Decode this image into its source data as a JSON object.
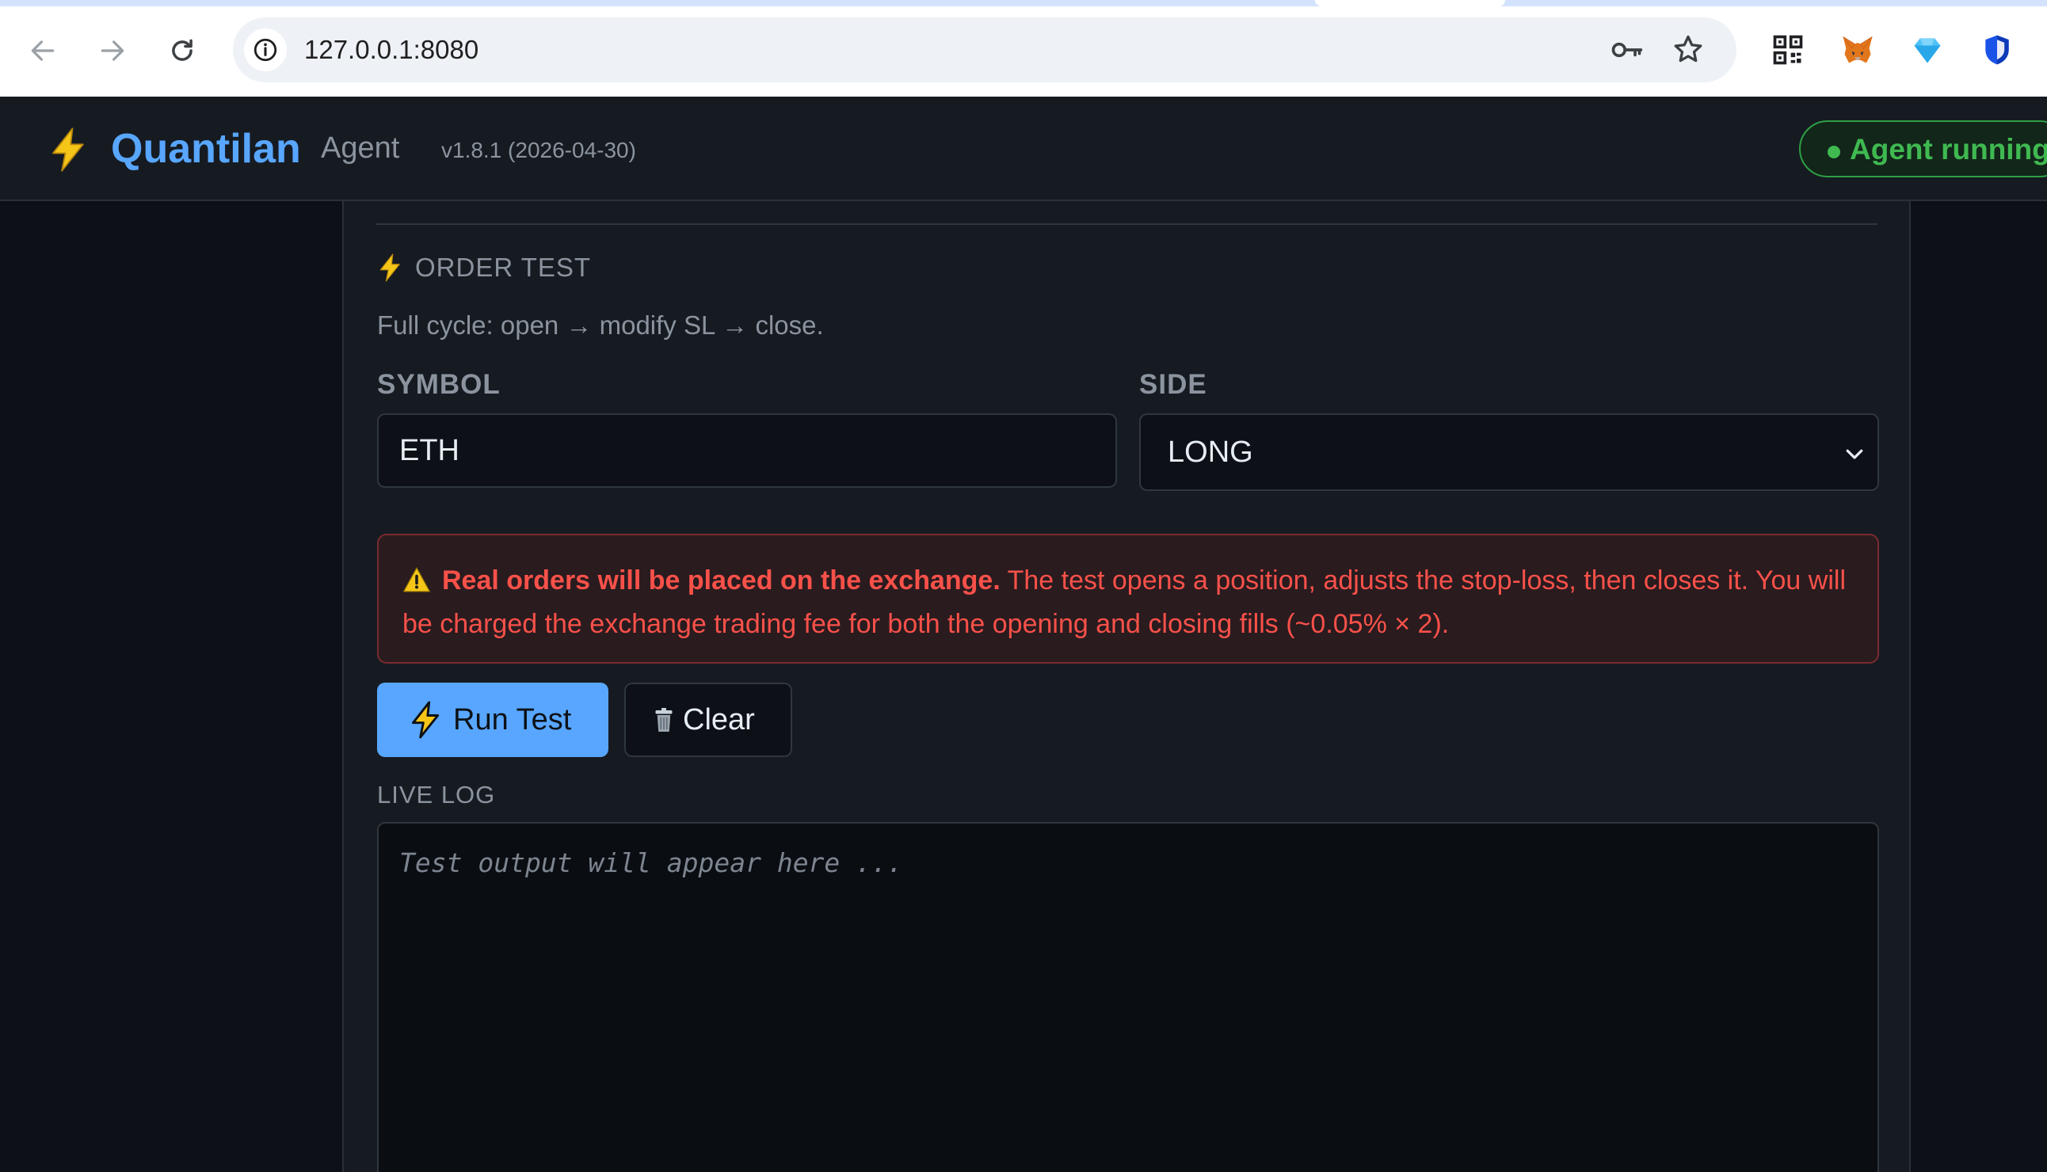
{
  "browser": {
    "url": "127.0.0.1:8080",
    "icons": [
      "back-arrow-icon",
      "forward-arrow-icon",
      "reload-icon",
      "site-info-icon",
      "password-key-icon",
      "bookmark-star-icon",
      "qr-code-extension-icon",
      "metamask-fox-extension-icon",
      "diamond-extension-icon",
      "shield-extension-icon"
    ]
  },
  "header": {
    "brand": "Quantilan",
    "subtitle": "Agent",
    "version": "v1.8.1 (2026-04-30)",
    "status": "Agent running",
    "accent_color": "#58a6ff",
    "status_color": "#3fb950"
  },
  "order_test": {
    "title": "ORDER TEST",
    "description": "Full cycle: open → modify SL → close.",
    "symbol_label": "SYMBOL",
    "symbol_value": "ETH",
    "side_label": "SIDE",
    "side_value": "LONG",
    "warning_bold": "Real orders will be placed on the exchange.",
    "warning_text": " The test opens a position, adjusts the stop-loss, then closes it. You will be charged the exchange trading fee for both the opening and closing fills (~0.05% × 2).",
    "warning_color": "#f85149",
    "run_label": "Run Test",
    "clear_label": "Clear",
    "log_label": "LIVE LOG",
    "log_placeholder": "Test output will appear here ..."
  }
}
